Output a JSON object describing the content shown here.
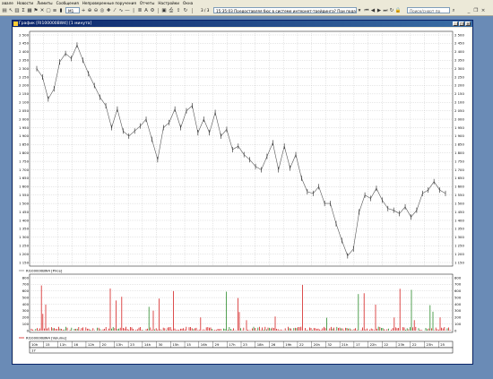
{
  "menu": [
    "авале",
    "Новости",
    "Лимиты",
    "Сообщения",
    "Непроверенные поручения",
    "Отчеты",
    "Настройки",
    "Окна"
  ],
  "toolbar": {
    "interval": "М1",
    "counter": "3 / 3",
    "news_ticker": "15:35:03  Предоставляя бюс в системе интернет-трейдинга?  При подаче пор",
    "search_placeholder": "Поиск/снорт пр"
  },
  "window": {
    "title": "График [RI100000BW4]  [1 минута]"
  },
  "chart_data": [
    {
      "type": "line",
      "title": "",
      "legend": [
        "RI100000BW4 [Price]"
      ],
      "ylim": [
        1150,
        2500
      ],
      "yticks": [
        "2 500",
        "2 450",
        "2 400",
        "2 350",
        "2 300",
        "2 250",
        "2 200",
        "2 150",
        "2 100",
        "2 050",
        "2 000",
        "1 950",
        "1 900",
        "1 850",
        "1 800",
        "1 750",
        "1 700",
        "1 650",
        "1 600",
        "1 550",
        "1 500",
        "1 450",
        "1 400",
        "1 350",
        "1 300",
        "1 250",
        "1 200",
        "1 150"
      ],
      "series": [
        {
          "name": "RI100000BW4 [Price]",
          "values": [
            2300,
            2250,
            2120,
            2180,
            2340,
            2390,
            2360,
            2440,
            2350,
            2270,
            2200,
            2130,
            2080,
            1950,
            2060,
            1930,
            1900,
            1930,
            1960,
            2000,
            1880,
            1760,
            1950,
            1980,
            2060,
            1950,
            2050,
            2080,
            1920,
            2000,
            1920,
            2040,
            1900,
            1940,
            1820,
            1840,
            1790,
            1760,
            1720,
            1700,
            1780,
            1860,
            1700,
            1840,
            1710,
            1790,
            1650,
            1570,
            1560,
            1600,
            1500,
            1500,
            1380,
            1280,
            1190,
            1230,
            1450,
            1550,
            1530,
            1590,
            1520,
            1470,
            1460,
            1440,
            1480,
            1420,
            1460,
            1560,
            1580,
            1630,
            1580,
            1560
          ]
        }
      ]
    },
    {
      "type": "bar",
      "title": "",
      "legend": [
        "RI100000BW4 [Volume]"
      ],
      "ylim": [
        0,
        800
      ],
      "yticks": [
        "800",
        "700",
        "600",
        "500",
        "400",
        "300",
        "200",
        "100",
        "0"
      ]
    }
  ],
  "time_axis": {
    "labels": [
      "10h",
      "15",
      "11h",
      "16",
      "12h",
      "20",
      "13h",
      "23",
      "14h",
      "30",
      "15h",
      "15",
      "16h",
      "29",
      "17h",
      "23",
      "18h",
      "26",
      "19h",
      "22",
      "20h",
      "32",
      "21h",
      "17",
      "22h",
      "22",
      "23h",
      "22",
      "23h",
      "25"
    ],
    "days": [
      "17"
    ]
  }
}
